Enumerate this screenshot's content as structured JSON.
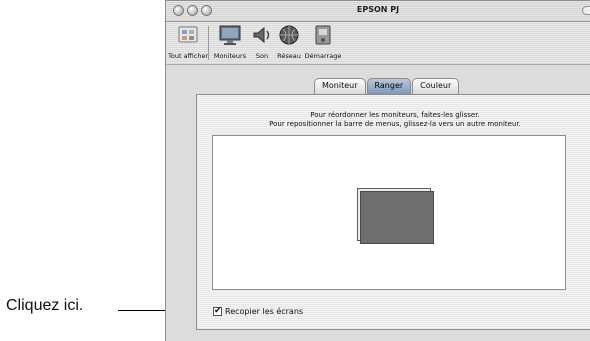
{
  "callout": {
    "text": "Cliquez ici."
  },
  "window": {
    "title": "EPSON PJ",
    "toolbar": {
      "items": [
        {
          "label": "Tout afficher",
          "icon": "show-all-icon"
        },
        {
          "label": "Moniteurs",
          "icon": "displays-icon"
        },
        {
          "label": "Son",
          "icon": "sound-icon"
        },
        {
          "label": "Réseau",
          "icon": "network-icon"
        },
        {
          "label": "Démarrage",
          "icon": "startup-disk-icon"
        }
      ]
    },
    "tabs": [
      {
        "label": "Moniteur",
        "selected": false
      },
      {
        "label": "Ranger",
        "selected": true
      },
      {
        "label": "Couleur",
        "selected": false
      }
    ],
    "instructions": {
      "line1": "Pour réordonner les moniteurs, faites-les glisser.",
      "line2": "Pour repositionner la barre de menus, glissez-la vers un autre moniteur."
    },
    "mirror_checkbox": {
      "label": "Recopier les écrans",
      "checked": true,
      "mark": "✔"
    }
  }
}
